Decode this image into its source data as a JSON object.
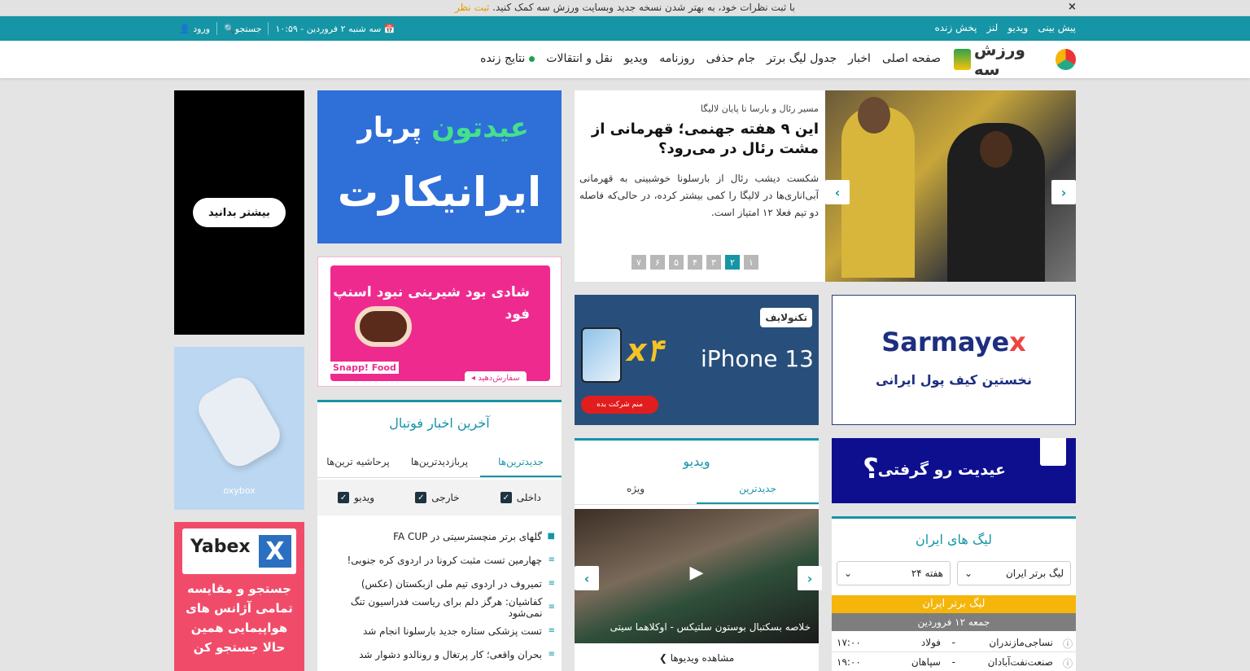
{
  "topbar": {
    "message": "با ثبت نظرات خود، به بهتر شدن نسخه جدید وبسایت ورزش سه کمک کنید.",
    "link": "ثبت نظر",
    "close": "×"
  },
  "tealbar": {
    "links": [
      "پیش بینی",
      "ویدیو",
      "لنز",
      "پخش زنده"
    ],
    "datetime": "سه شنبه ۲ فروردین - ۱۰:۵۹",
    "search": "جستجو",
    "login": "ورود"
  },
  "nav": {
    "logo": "ورزش سه",
    "items": [
      "صفحه اصلی",
      "اخبار",
      "جدول لیگ برتر",
      "جام حذفی",
      "روزنامه",
      "ویدیو",
      "نقل و انتقالات",
      "نتایج زنده"
    ]
  },
  "slider": {
    "subtitle": "مسیر رئال و بارسا تا پایان لالیگا",
    "title": "این ۹ هفته جهنمی؛ قهرمانی از مشت رئال در می‌رود؟",
    "desc": "شکست دیشب رئال از بارسلونا خوشبینی به قهرمانی آبی‌اناری‌ها در لالیگا را کمی بیشتر کرده، در حالی‌که فاصله دو تیم فعلا ۱۲ امتیاز است.",
    "pages": [
      "۱",
      "۲",
      "۳",
      "۴",
      "۵",
      "۶",
      "۷"
    ],
    "active_page": "۲"
  },
  "ads": {
    "black_button": "بیشتر بدانید",
    "iranicard_line1_a": "عیدتون",
    "iranicard_line1_b": "پربار",
    "iranicard_line2": "ایرانیکارت",
    "snapp_text": "شادی بود شیرینی نبود اسنپ فود",
    "snapp_logo": "Snapp! Food",
    "snapp_order": "سفارش‌دهید ◂",
    "iphone_brand": "تکنولایف",
    "iphone_model": "iPhone 13",
    "iphone_x4": "x۴",
    "iphone_cta": "منم شرکت بده",
    "sarmayex_brand_a": "Sarmaye",
    "sarmayex_brand_b": "x",
    "sarmayex_sub": "نخستین کیف پول ایرانی",
    "blue_text": "عیدیت رو گرفتی",
    "blue_q": "؟",
    "oxy_logo": "oxybox",
    "yabex_name": "Yabex",
    "yabex_x": "X",
    "yabex_text": "جستجو و مقایسه تمامی آژانس های هواپیمایی همین حالا جستجو کن"
  },
  "news": {
    "title": "آخرین اخبار فوتبال",
    "tabs": [
      "جدیدترین‌ها",
      "پربازدیدترین‌ها",
      "پرحاشیه ترین‌ها"
    ],
    "filters": [
      "داخلی",
      "خارجی",
      "ویدیو"
    ],
    "items": [
      "گلهای برتر منچسترسیتی در FA CUP",
      "چهارمین تست مثبت کرونا در اردوی کره جنوبی!",
      "تمیروف در اردوی تیم ملی ازبکستان (عکس)",
      "کفاشیان: هرگز دلم برای ریاست فدراسیون تنگ نمی‌شود",
      "تست پزشکی ستاره جدید بارسلونا انجام شد",
      "بحران واقعی؛ کار پرتغال و رونالدو دشوار شد"
    ]
  },
  "video": {
    "title": "ویدیو",
    "tabs": [
      "جدیدترین",
      "ویژه"
    ],
    "caption": "خلاصه بسکتبال بوستون سلتیکس - اوکلاهما سیتی",
    "more": "مشاهده ویدیوها ❯"
  },
  "league": {
    "title": "لیگ های ایران",
    "select_league": "لیگ برتر ایران",
    "select_week": "هفته ۲۴",
    "bar": "لیگ برتر ایران",
    "date": "جمعه ۱۲ فروردین",
    "matches": [
      {
        "home": "نساجی‌مازندران",
        "away": "فولاد",
        "time": "۱۷:۰۰"
      },
      {
        "home": "صنعت‌نفت‌آبادان",
        "away": "سپاهان",
        "time": "۱۹:۰۰"
      }
    ]
  }
}
